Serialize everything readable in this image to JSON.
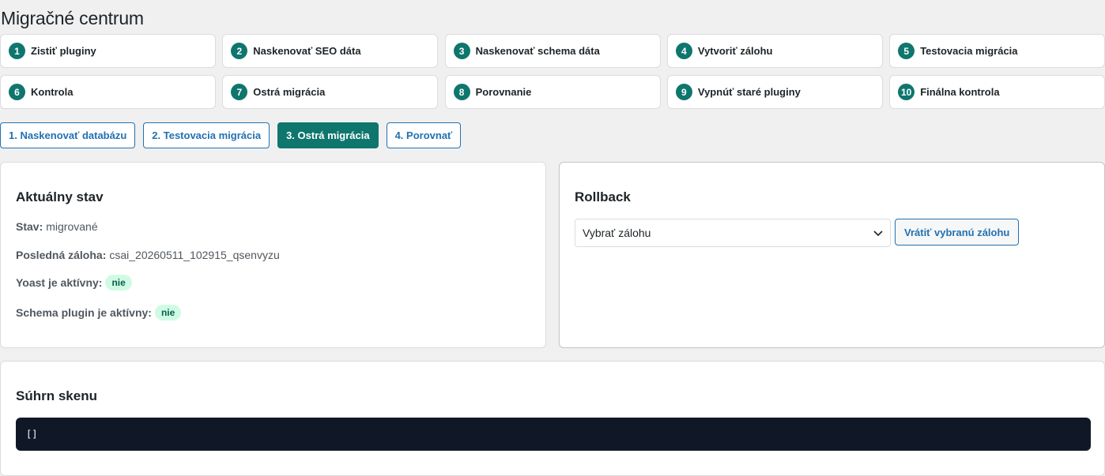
{
  "page": {
    "title": "Migračné centrum"
  },
  "steps": [
    {
      "num": "1",
      "label": "Zistiť pluginy"
    },
    {
      "num": "2",
      "label": "Naskenovať SEO dáta"
    },
    {
      "num": "3",
      "label": "Naskenovať schema dáta"
    },
    {
      "num": "4",
      "label": "Vytvoriť zálohu"
    },
    {
      "num": "5",
      "label": "Testovacia migrácia"
    },
    {
      "num": "6",
      "label": "Kontrola"
    },
    {
      "num": "7",
      "label": "Ostrá migrácia"
    },
    {
      "num": "8",
      "label": "Porovnanie"
    },
    {
      "num": "9",
      "label": "Vypnúť staré pluginy"
    },
    {
      "num": "10",
      "label": "Finálna kontrola"
    }
  ],
  "tabs": [
    {
      "label": "1. Naskenovať databázu",
      "active": false
    },
    {
      "label": "2. Testovacia migrácia",
      "active": false
    },
    {
      "label": "3. Ostrá migrácia",
      "active": true
    },
    {
      "label": "4. Porovnať",
      "active": false
    }
  ],
  "status_card": {
    "title": "Aktuálny stav",
    "state_label": "Stav:",
    "state_value": "migrované",
    "backup_label": "Posledná záloha:",
    "backup_value": "csai_20260511_102915_qsenvyzu",
    "yoast_label": "Yoast je aktívny:",
    "yoast_value": "nie",
    "schema_label": "Schema plugin je aktívny:",
    "schema_value": "nie"
  },
  "rollback_card": {
    "title": "Rollback",
    "select_value": "Vybrať zálohu",
    "button_label": "Vrátiť vybranú zálohu"
  },
  "summary_card": {
    "title": "Súhrn skenu",
    "code": "[]"
  },
  "colors": {
    "accent": "#0f766e",
    "link": "#2271b1",
    "badge_bg": "#d1fae5",
    "badge_text": "#065f46",
    "code_bg": "#101828"
  }
}
